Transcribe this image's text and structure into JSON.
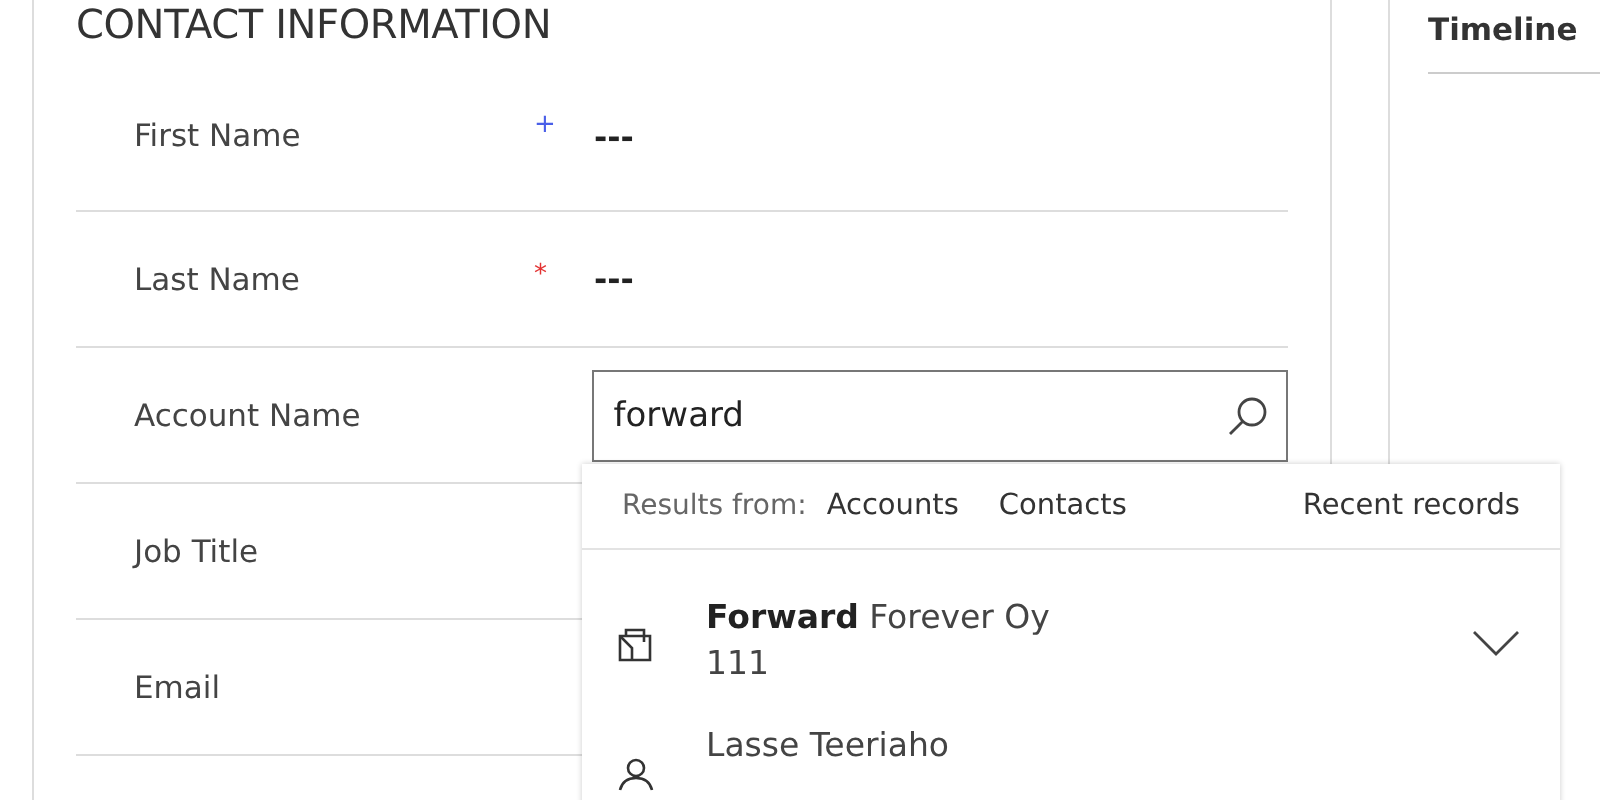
{
  "section": {
    "title": "CONTACT INFORMATION"
  },
  "fields": [
    {
      "label": "First Name",
      "marker": "+",
      "color": "#4a5fe8",
      "kind": "text",
      "value": "---"
    },
    {
      "label": "Last Name",
      "marker": "*",
      "color": "#e33333",
      "kind": "text",
      "value": "---"
    },
    {
      "label": "Account Name",
      "kind": "lookup",
      "value": "forward"
    },
    {
      "label": "Job Title",
      "kind": "text"
    },
    {
      "label": "Email",
      "kind": "text"
    }
  ],
  "lookup_results": {
    "prefix": "Results from:",
    "filters": [
      "Accounts",
      "Contacts"
    ],
    "recent": "Recent records",
    "items": [
      {
        "kind": "account",
        "match": "Forward",
        "rest": " Forever Oy",
        "subtitle": "111",
        "expandable": true
      },
      {
        "kind": "contact",
        "rest": "Lasse Teeriaho",
        "expandable": false
      }
    ]
  },
  "timeline": {
    "title": "Timeline"
  }
}
